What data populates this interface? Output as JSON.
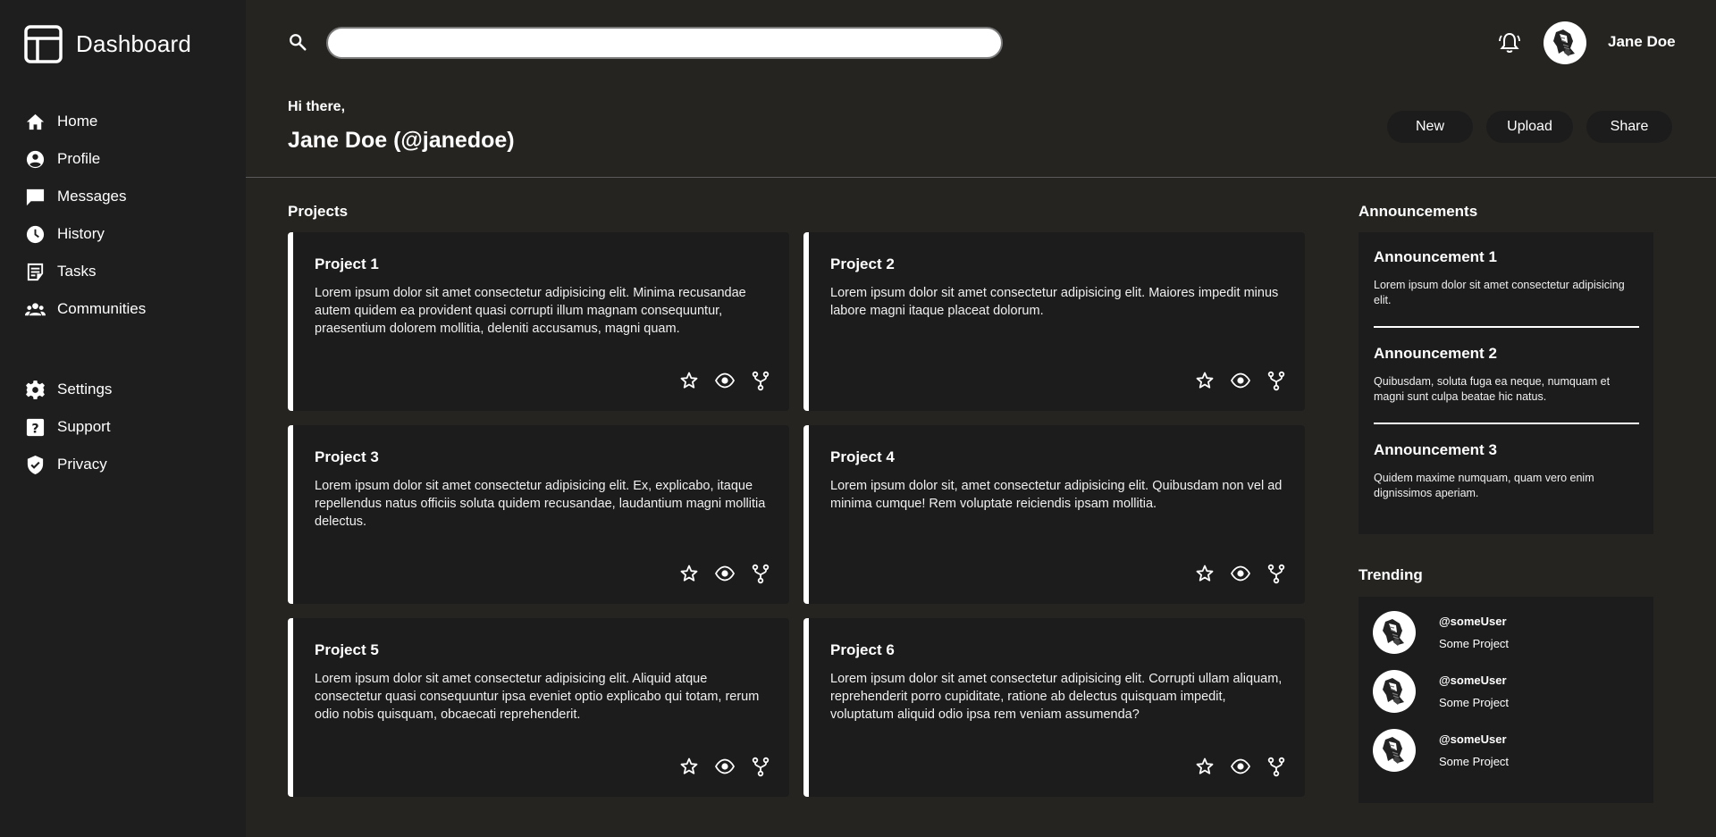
{
  "app": {
    "title": "Dashboard"
  },
  "sidebar": {
    "items": [
      {
        "label": "Home",
        "icon": "home-icon"
      },
      {
        "label": "Profile",
        "icon": "profile-icon"
      },
      {
        "label": "Messages",
        "icon": "messages-icon"
      },
      {
        "label": "History",
        "icon": "history-icon"
      },
      {
        "label": "Tasks",
        "icon": "tasks-icon"
      },
      {
        "label": "Communities",
        "icon": "communities-icon"
      },
      {
        "label": "Settings",
        "icon": "settings-icon"
      },
      {
        "label": "Support",
        "icon": "support-icon"
      },
      {
        "label": "Privacy",
        "icon": "privacy-icon"
      }
    ]
  },
  "header": {
    "search": {
      "value": "",
      "placeholder": ""
    },
    "user_name": "Jane Doe"
  },
  "greeting": {
    "small": "Hi there,",
    "big": "Jane Doe (@janedoe)"
  },
  "actions": {
    "new": "New",
    "upload": "Upload",
    "share": "Share"
  },
  "projects": {
    "title": "Projects",
    "items": [
      {
        "title": "Project 1",
        "text": "Lorem ipsum dolor sit amet consectetur adipisicing elit. Minima recusandae autem quidem ea provident quasi corrupti illum magnam consequuntur, praesentium dolorem mollitia, deleniti accusamus, magni quam."
      },
      {
        "title": "Project 2",
        "text": "Lorem ipsum dolor sit amet consectetur adipisicing elit. Maiores impedit minus labore magni itaque placeat dolorum."
      },
      {
        "title": "Project 3",
        "text": "Lorem ipsum dolor sit amet consectetur adipisicing elit. Ex, explicabo, itaque repellendus natus officiis soluta quidem recusandae, laudantium magni mollitia delectus."
      },
      {
        "title": "Project 4",
        "text": "Lorem ipsum dolor sit, amet consectetur adipisicing elit. Quibusdam non vel ad minima cumque! Rem voluptate reiciendis ipsam mollitia."
      },
      {
        "title": "Project 5",
        "text": "Lorem ipsum dolor sit amet consectetur adipisicing elit. Aliquid atque consectetur quasi consequuntur ipsa eveniet optio explicabo qui totam, rerum odio nobis quisquam, obcaecati reprehenderit."
      },
      {
        "title": "Project 6",
        "text": "Lorem ipsum dolor sit amet consectetur adipisicing elit. Corrupti ullam aliquam, reprehenderit porro cupiditate, ratione ab delectus quisquam impedit, voluptatum aliquid odio ipsa rem veniam assumenda?"
      }
    ]
  },
  "announcements": {
    "title": "Announcements",
    "items": [
      {
        "title": "Announcement 1",
        "text": "Lorem ipsum dolor sit amet consectetur adipisicing elit."
      },
      {
        "title": "Announcement 2",
        "text": "Quibusdam, soluta fuga ea neque, numquam et magni sunt culpa beatae hic natus."
      },
      {
        "title": "Announcement 3",
        "text": "Quidem maxime numquam, quam vero enim dignissimos aperiam."
      }
    ]
  },
  "trending": {
    "title": "Trending",
    "items": [
      {
        "user": "@someUser",
        "project": "Some Project"
      },
      {
        "user": "@someUser",
        "project": "Some Project"
      },
      {
        "user": "@someUser",
        "project": "Some Project"
      }
    ]
  },
  "colors": {
    "background": "#252420",
    "sidebar": "#1e1e1e",
    "card": "#1c1c1c",
    "accent": "#ffffff"
  }
}
